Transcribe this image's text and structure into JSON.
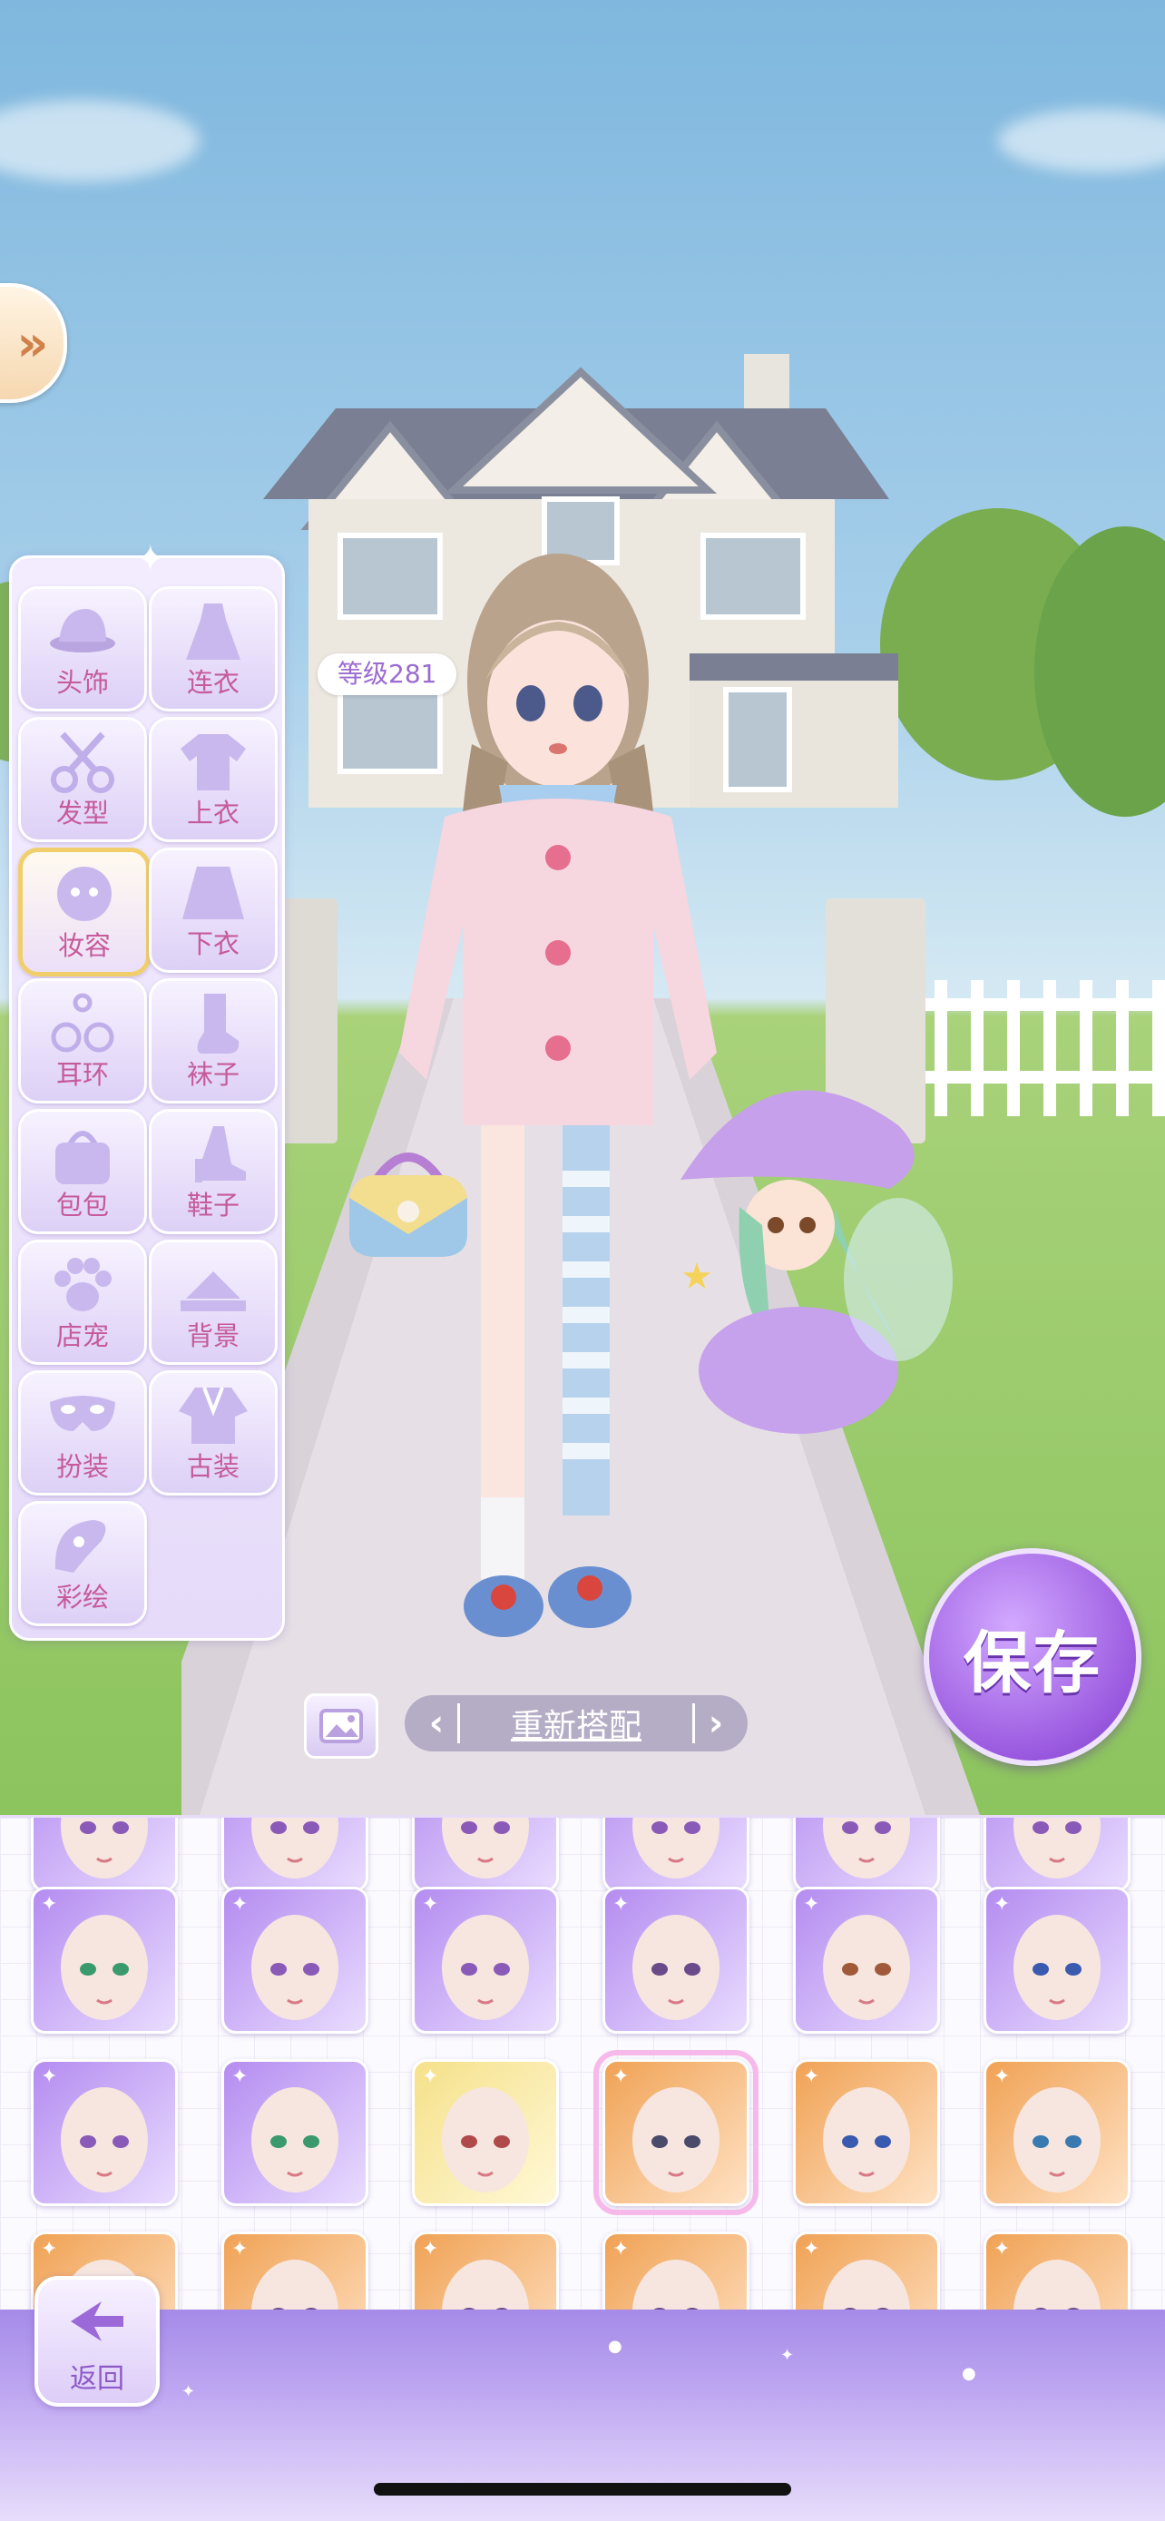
{
  "level": {
    "text": "等级281"
  },
  "categories": [
    {
      "label": "头饰",
      "icon": "hat-icon"
    },
    {
      "label": "连衣",
      "icon": "dress-icon"
    },
    {
      "label": "发型",
      "icon": "scissors-icon"
    },
    {
      "label": "上衣",
      "icon": "shirt-icon"
    },
    {
      "label": "妆容",
      "icon": "makeup-face-icon",
      "selected": true
    },
    {
      "label": "下衣",
      "icon": "skirt-icon"
    },
    {
      "label": "耳环",
      "icon": "earring-icon"
    },
    {
      "label": "袜子",
      "icon": "sock-icon"
    },
    {
      "label": "包包",
      "icon": "handbag-icon"
    },
    {
      "label": "鞋子",
      "icon": "heel-shoe-icon"
    },
    {
      "label": "店宠",
      "icon": "paw-icon"
    },
    {
      "label": "背景",
      "icon": "background-icon"
    },
    {
      "label": "扮装",
      "icon": "mask-icon"
    },
    {
      "label": "古装",
      "icon": "hanfu-icon"
    },
    {
      "label": "彩绘",
      "icon": "paint-icon"
    }
  ],
  "controls": {
    "remix_label": "重新搭配",
    "save_label": "保存",
    "back_label": "返回"
  },
  "items": {
    "row1": [
      "purple",
      "purple",
      "purple",
      "purple",
      "purple",
      "purple"
    ],
    "row2": [
      "purple",
      "purple",
      "yellow",
      "orange",
      "orange",
      "orange"
    ],
    "selected_index_row2": 3,
    "eye_colors_row1": [
      "#3a9a6e",
      "#8a5ab8",
      "#8a5ab8",
      "#6b4a8a",
      "#a05a3a",
      "#3a5ab0"
    ],
    "eye_colors_row2": [
      "#8a5ab8",
      "#3a9a6e",
      "#b04a4a",
      "#4a4a6a",
      "#3a5ab0",
      "#3a7ab0"
    ]
  },
  "colors": {
    "accent_purple": "#9b5ae0",
    "label_pink": "#c65a9b",
    "selected_gold": "#f0cf6a"
  }
}
